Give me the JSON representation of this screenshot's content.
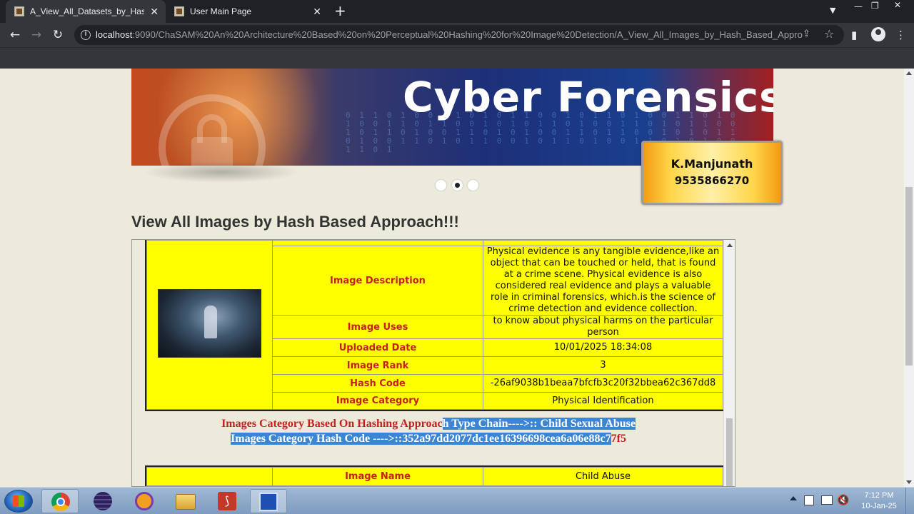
{
  "browser": {
    "tabs": [
      {
        "title": "A_View_All_Datasets_by_Hash_Ba",
        "active": true
      },
      {
        "title": "User Main Page",
        "active": false
      }
    ],
    "url_host": "localhost",
    "url_rest": ":9090/ChaSAM%20An%20Architecture%20Based%20on%20Perceptual%20Hashing%20for%20Image%20Detection/A_View_All_Images_by_Hash_Based_Approa..."
  },
  "banner": {
    "title": "Cyber Forensics",
    "name": "K.Manjunath",
    "phone": "9535866270"
  },
  "page": {
    "heading": "View All Images by Hash Based Approach!!!"
  },
  "record": {
    "rows": [
      {
        "label": "Image Description",
        "value": "Physical evidence is any tangible evidence,like an object that can be touched or held, that is found at a crime scene. Physical evidence is also considered real evidence and plays a valuable role in criminal forensics, which.is the science of crime detection and evidence collection."
      },
      {
        "label": "Image Uses",
        "value": "to know about physical harms on the particular person"
      },
      {
        "label": "Uploaded Date",
        "value": "10/01/2025 18:34:08"
      },
      {
        "label": "Image Rank",
        "value": "3"
      },
      {
        "label": "Hash Code",
        "value": "-26af9038b1beaa7bfcfb3c20f32bbea62c367dd8"
      },
      {
        "label": "Image Category",
        "value": "Physical Identification"
      }
    ]
  },
  "category": {
    "line1_plain": "Images Category Based On Hashing Approac",
    "line1_sel": "h Type Chain---->:: Child Sexual Abuse",
    "line2_sel": "Images Category Hash Code ---->::352a97dd2077dc1ee16396698cea6a06e88c7",
    "line2_plain": "7f5"
  },
  "record2": {
    "label": "Image Name",
    "value": "Child Abuse"
  },
  "taskbar": {
    "time": "7:12 PM",
    "date": "10-Jan-25"
  }
}
